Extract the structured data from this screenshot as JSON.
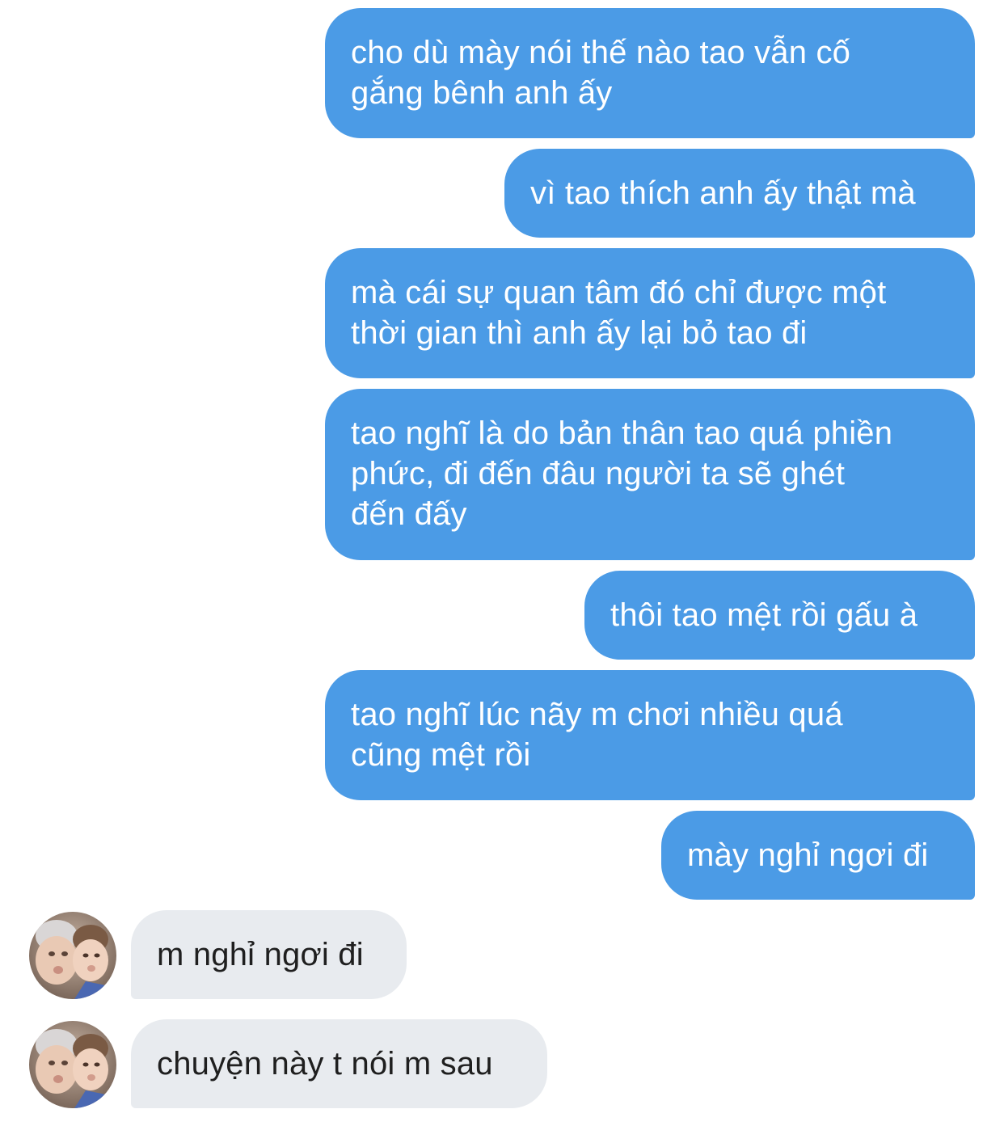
{
  "conversation": {
    "outgoing": [
      {
        "text": "cho dù mày nói thế nào tao vẫn cố\ngắng bênh anh ấy"
      },
      {
        "text": "vì tao thích anh ấy thật mà"
      },
      {
        "text": "mà cái sự quan tâm đó chỉ được một\nthời gian thì anh ấy lại bỏ tao đi"
      },
      {
        "text": "tao nghĩ là do bản thân tao quá phiền\nphức, đi đến đâu người ta sẽ ghét\nđến đấy"
      },
      {
        "text": "thôi tao mệt rồi gấu à"
      },
      {
        "text": "tao nghĩ lúc nãy m chơi nhiều quá\ncũng mệt rồi"
      },
      {
        "text": "mày nghỉ ngơi đi"
      }
    ],
    "incoming": [
      {
        "text": "m nghỉ ngơi đi"
      },
      {
        "text": "chuyện này t nói m sau"
      }
    ]
  },
  "colors": {
    "outgoing_bubble": "#4b9be6",
    "incoming_bubble": "#e8ebef"
  },
  "icons": {
    "contact_avatar": "contact-avatar-photo"
  }
}
